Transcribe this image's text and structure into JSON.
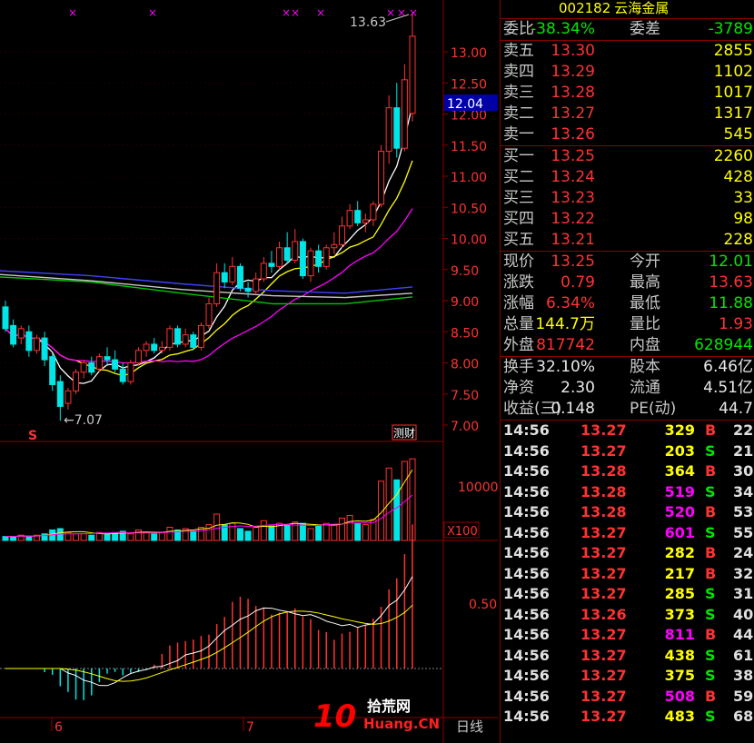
{
  "stock": {
    "code": "002182",
    "name": "云海金属"
  },
  "weibi": {
    "label": "委比",
    "value": "-38.34%",
    "label2": "委差",
    "value2": "-3789"
  },
  "sells": [
    {
      "label": "卖五",
      "price": "13.30",
      "vol": "2855"
    },
    {
      "label": "卖四",
      "price": "13.29",
      "vol": "1102"
    },
    {
      "label": "卖三",
      "price": "13.28",
      "vol": "1017"
    },
    {
      "label": "卖二",
      "price": "13.27",
      "vol": "1317"
    },
    {
      "label": "卖一",
      "price": "13.26",
      "vol": "545"
    }
  ],
  "buys": [
    {
      "label": "买一",
      "price": "13.25",
      "vol": "2260"
    },
    {
      "label": "买二",
      "price": "13.24",
      "vol": "428"
    },
    {
      "label": "买三",
      "price": "13.23",
      "vol": "33"
    },
    {
      "label": "买四",
      "price": "13.22",
      "vol": "98"
    },
    {
      "label": "买五",
      "price": "13.21",
      "vol": "228"
    }
  ],
  "quote": [
    {
      "l1": "现价",
      "v1": "13.25",
      "c1": "red",
      "l2": "今开",
      "v2": "12.01",
      "c2": "green"
    },
    {
      "l1": "涨跌",
      "v1": "0.79",
      "c1": "red",
      "l2": "最高",
      "v2": "13.63",
      "c2": "red"
    },
    {
      "l1": "涨幅",
      "v1": "6.34%",
      "c1": "red",
      "l2": "最低",
      "v2": "11.88",
      "c2": "green"
    },
    {
      "l1": "总量",
      "v1": "144.7万",
      "c1": "yellow",
      "l2": "量比",
      "v2": "1.93",
      "c2": "red"
    },
    {
      "l1": "外盘",
      "v1": "817742",
      "c1": "red",
      "l2": "内盘",
      "v2": "628944",
      "c2": "green"
    }
  ],
  "fund": [
    {
      "l1": "换手",
      "v1": "32.10%",
      "l2": "股本",
      "v2": "6.46亿"
    },
    {
      "l1": "净资",
      "v1": "2.30",
      "l2": "流通",
      "v2": "4.51亿"
    },
    {
      "l1": "收益(三)",
      "v1": "0.148",
      "l2": "PE(动)",
      "v2": "44.7"
    }
  ],
  "ticks": [
    {
      "time": "14:56",
      "price": "13.27",
      "vol": "329",
      "vc": "yellow",
      "bs": "B",
      "bc": "red",
      "n": "22"
    },
    {
      "time": "14:56",
      "price": "13.27",
      "vol": "203",
      "vc": "yellow",
      "bs": "S",
      "bc": "green",
      "n": "21"
    },
    {
      "time": "14:56",
      "price": "13.28",
      "vol": "364",
      "vc": "yellow",
      "bs": "B",
      "bc": "red",
      "n": "30"
    },
    {
      "time": "14:56",
      "price": "13.28",
      "vol": "519",
      "vc": "magenta",
      "bs": "S",
      "bc": "green",
      "n": "34"
    },
    {
      "time": "14:56",
      "price": "13.28",
      "vol": "520",
      "vc": "magenta",
      "bs": "B",
      "bc": "red",
      "n": "53"
    },
    {
      "time": "14:56",
      "price": "13.27",
      "vol": "601",
      "vc": "magenta",
      "bs": "S",
      "bc": "green",
      "n": "55"
    },
    {
      "time": "14:56",
      "price": "13.27",
      "vol": "282",
      "vc": "yellow",
      "bs": "B",
      "bc": "red",
      "n": "24"
    },
    {
      "time": "14:56",
      "price": "13.27",
      "vol": "217",
      "vc": "yellow",
      "bs": "B",
      "bc": "red",
      "n": "32"
    },
    {
      "time": "14:56",
      "price": "13.27",
      "vol": "285",
      "vc": "yellow",
      "bs": "S",
      "bc": "green",
      "n": "31"
    },
    {
      "time": "14:56",
      "price": "13.26",
      "vol": "373",
      "vc": "yellow",
      "bs": "S",
      "bc": "green",
      "n": "40"
    },
    {
      "time": "14:56",
      "price": "13.27",
      "vol": "811",
      "vc": "magenta",
      "bs": "B",
      "bc": "red",
      "n": "44"
    },
    {
      "time": "14:56",
      "price": "13.27",
      "vol": "438",
      "vc": "yellow",
      "bs": "S",
      "bc": "green",
      "n": "61"
    },
    {
      "time": "14:56",
      "price": "13.27",
      "vol": "375",
      "vc": "yellow",
      "bs": "S",
      "bc": "green",
      "n": "38"
    },
    {
      "time": "14:56",
      "price": "13.27",
      "vol": "508",
      "vc": "magenta",
      "bs": "B",
      "bc": "red",
      "n": "59"
    },
    {
      "time": "14:56",
      "price": "13.27",
      "vol": "483",
      "vc": "yellow",
      "bs": "S",
      "bc": "green",
      "n": "68"
    }
  ],
  "chart": {
    "price_ticks": [
      "13.00",
      "12.50",
      "12.00",
      "11.50",
      "11.00",
      "10.50",
      "10.00",
      "9.50",
      "9.00",
      "8.50",
      "8.00",
      "7.50",
      "7.00"
    ],
    "current_price_tag": "12.04",
    "high_label": "13.63",
    "low_label": "7.07",
    "vol_tick": "10000",
    "vol_unit": "X100",
    "ind_tick": "0.50",
    "month_labels": [
      "6",
      "7"
    ],
    "period_label": "日线",
    "s_marker": "S",
    "event_marker": "测财",
    "watermark_left": "10",
    "watermark_right_top": "拾荒网",
    "watermark_right_bottom": "Huang.CN"
  },
  "colors": {
    "up": "#ff3232",
    "down": "#00e5e5",
    "ma5": "#ffffff",
    "ma10": "#ffff00",
    "ma20": "#ff00ff",
    "ma60": "#00c800",
    "ma120": "#4040ff",
    "ma250": "#c8c8c8",
    "frame": "#8b0000"
  }
}
